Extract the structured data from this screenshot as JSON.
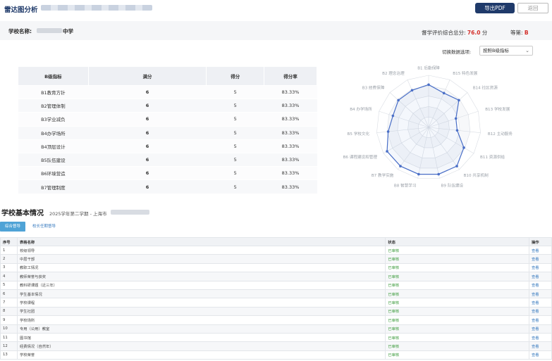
{
  "header": {
    "title": "雷达图分析",
    "export_button": "导出PDF",
    "back_button": "返回"
  },
  "info": {
    "school_label": "学校名称:",
    "school_name": "中学",
    "score_label": "督学评价综合总分:",
    "score_value": "76.0",
    "score_unit": "分",
    "grade_label": "等第:",
    "grade_value": "B"
  },
  "switch": {
    "label": "切换数据选项:",
    "selected": "按照B级指标"
  },
  "btable": {
    "headers": [
      "B级指标",
      "满分",
      "得分",
      "得分率"
    ],
    "rows": [
      [
        "B1教育方针",
        "6",
        "5",
        "83.33%"
      ],
      [
        "B2管理体制",
        "6",
        "5",
        "83.33%"
      ],
      [
        "B3学业减负",
        "6",
        "5",
        "83.33%"
      ],
      [
        "B4办学场所",
        "6",
        "5",
        "83.33%"
      ],
      [
        "B4顶层设计",
        "6",
        "5",
        "83.33%"
      ],
      [
        "B5队伍建设",
        "6",
        "5",
        "83.33%"
      ],
      [
        "B6环境营造",
        "6",
        "5",
        "83.33%"
      ],
      [
        "B7管理制度",
        "6",
        "5",
        "83.33%"
      ]
    ]
  },
  "radar": {
    "labels": [
      "B1 后勤保障",
      "B15 特色发展",
      "B14 社区资源",
      "B13 学校发展",
      "B12 主动服务",
      "B11 资源供给",
      "B10 共享机制",
      "B9 队伍建设",
      "B8 智慧学习",
      "B7 教学实施",
      "B6 课程建设和管理",
      "B5 学校文化",
      "B4 办学场所",
      "B3 经费保障",
      "B2 理念治理"
    ],
    "values": [
      0.82,
      0.72,
      0.78,
      0.55,
      0.55,
      0.78,
      0.92,
      0.92,
      0.92,
      0.92,
      0.92,
      0.78,
      0.72,
      0.78,
      0.78
    ],
    "max": 1,
    "rings": 5,
    "colors": {
      "line": "#4a6fc7",
      "fill": "rgba(74,111,199,0.06)",
      "grid": "#d9dde3",
      "label": "#9aa0a8"
    }
  },
  "section": {
    "title": "学校基本情况",
    "subtitle": "2025学年第二学期 - 上海市"
  },
  "tabs": [
    "综合督导",
    "校长任期督导"
  ],
  "ltable": {
    "headers": [
      "序号",
      "表格名称",
      "状态",
      "操作"
    ],
    "rows": [
      [
        "1",
        "校级领导",
        "已审核",
        "查看"
      ],
      [
        "2",
        "中层干部",
        "已审核",
        "查看"
      ],
      [
        "3",
        "教职工情况",
        "已审核",
        "查看"
      ],
      [
        "4",
        "教师荣誉与获奖",
        "已审核",
        "查看"
      ],
      [
        "5",
        "教科研课题（近三年）",
        "已审核",
        "查看"
      ],
      [
        "6",
        "学生基本情况",
        "已审核",
        "查看"
      ],
      [
        "7",
        "学校课程",
        "已审核",
        "查看"
      ],
      [
        "8",
        "学生社团",
        "已审核",
        "查看"
      ],
      [
        "9",
        "学校场所",
        "已审核",
        "查看"
      ],
      [
        "10",
        "专用（公用）教室",
        "已审核",
        "查看"
      ],
      [
        "11",
        "图书馆",
        "已审核",
        "查看"
      ],
      [
        "12",
        "经费情况（自然年）",
        "已审核",
        "查看"
      ],
      [
        "13",
        "学校荣誉",
        "已审核",
        "查看"
      ]
    ]
  }
}
